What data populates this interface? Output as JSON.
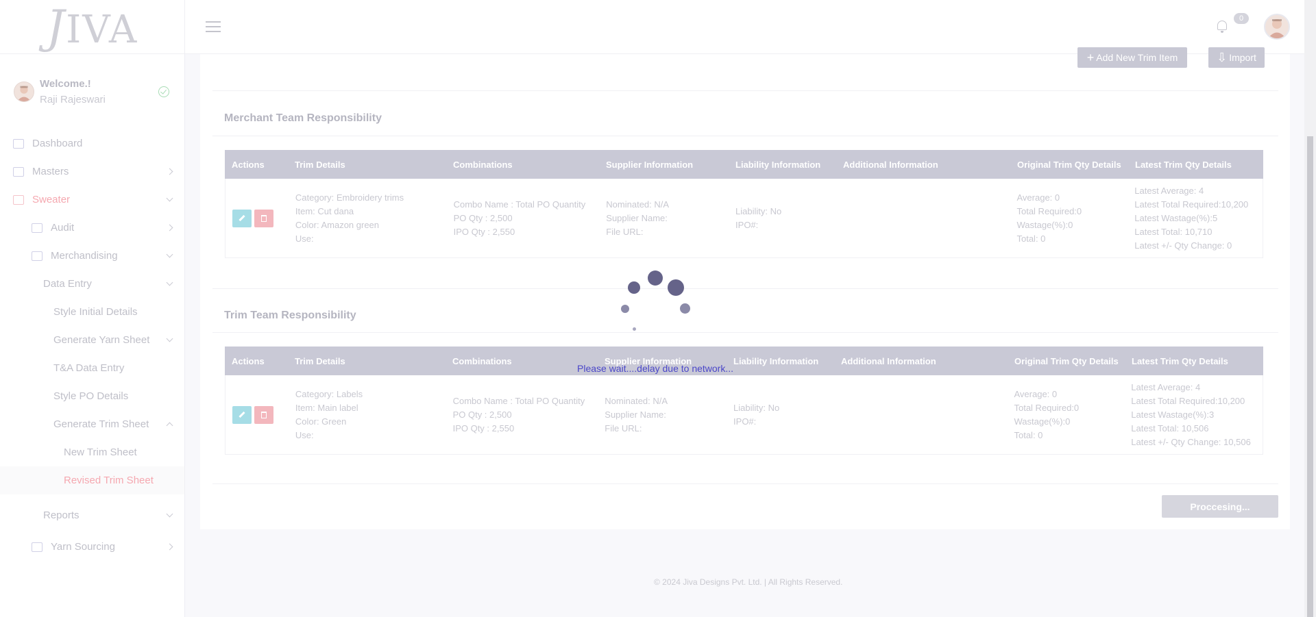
{
  "brand": {
    "logo_text": "IVA",
    "logo_letter": "J"
  },
  "profile": {
    "welcome": "Welcome.!",
    "name": "Raji Rajeswari"
  },
  "notifications": {
    "count": "0"
  },
  "sidebar": {
    "items": [
      {
        "label": "Dashboard"
      },
      {
        "label": "Masters"
      },
      {
        "label": "Sweater"
      },
      {
        "label": "Audit"
      },
      {
        "label": "Merchandising"
      },
      {
        "label": "Data Entry"
      },
      {
        "label": "Style Initial Details"
      },
      {
        "label": "Generate Yarn Sheet"
      },
      {
        "label": "T&A Data Entry"
      },
      {
        "label": "Style PO Details"
      },
      {
        "label": "Generate Trim Sheet"
      },
      {
        "label": "New Trim Sheet"
      },
      {
        "label": "Revised Trim Sheet"
      },
      {
        "label": "Reports"
      },
      {
        "label": "Yarn Sourcing"
      }
    ]
  },
  "actions": {
    "add_trim": "Add New Trim Item",
    "import": "Import",
    "processing": "Proccesing..."
  },
  "columns": [
    "Actions",
    "Trim Details",
    "Combinations",
    "Supplier Information",
    "Liability Information",
    "Additional Information",
    "Original Trim Qty Details",
    "Latest Trim Qty Details"
  ],
  "merchant": {
    "title": "Merchant Team Responsibility",
    "row": {
      "trim": [
        "Category: Embroidery trims",
        "Item: Cut dana",
        "Color: Amazon green",
        "Use:"
      ],
      "combo": [
        "Combo Name : Total PO Quantity",
        "PO Qty : 2,500",
        "IPO Qty : 2,550"
      ],
      "supplier": [
        "Nominated: N/A",
        "Supplier Name:",
        "File URL:"
      ],
      "liability": [
        "Liability: No",
        "IPO#:"
      ],
      "original": [
        "Average: 0",
        "Total Required:0",
        "Wastage(%):0",
        "Total: 0"
      ],
      "latest": [
        "Latest Average: 4",
        "Latest Total Required:10,200",
        "Latest Wastage(%):5",
        "Latest Total: 10,710",
        "Latest +/- Qty Change: 0"
      ]
    }
  },
  "trim": {
    "title": "Trim Team Responsibility",
    "row": {
      "trim": [
        "Category: Labels",
        "Item: Main label",
        "Color: Green",
        "Use:"
      ],
      "combo": [
        "Combo Name : Total PO Quantity",
        "PO Qty : 2,500",
        "IPO Qty : 2,550"
      ],
      "supplier": [
        "Nominated: N/A",
        "Supplier Name:",
        "File URL:"
      ],
      "liability": [
        "Liability: No",
        "IPO#:"
      ],
      "original": [
        "Average: 0",
        "Total Required:0",
        "Wastage(%):0",
        "Total: 0"
      ],
      "latest": [
        "Latest Average: 4",
        "Latest Total Required:10,200",
        "Latest Wastage(%):3",
        "Latest Total: 10,506",
        "Latest +/- Qty Change: 10,506"
      ]
    }
  },
  "loading": {
    "message": "Please wait....delay due to network..."
  },
  "footer": {
    "text": "© 2024 Jiva Designs Pvt. Ltd. | All Rights Reserved."
  },
  "colors": {
    "accent_active": "#f5a8b0",
    "table_header": "#c9c9d6",
    "loader": "#656389",
    "loading_text": "#4a46c8"
  }
}
